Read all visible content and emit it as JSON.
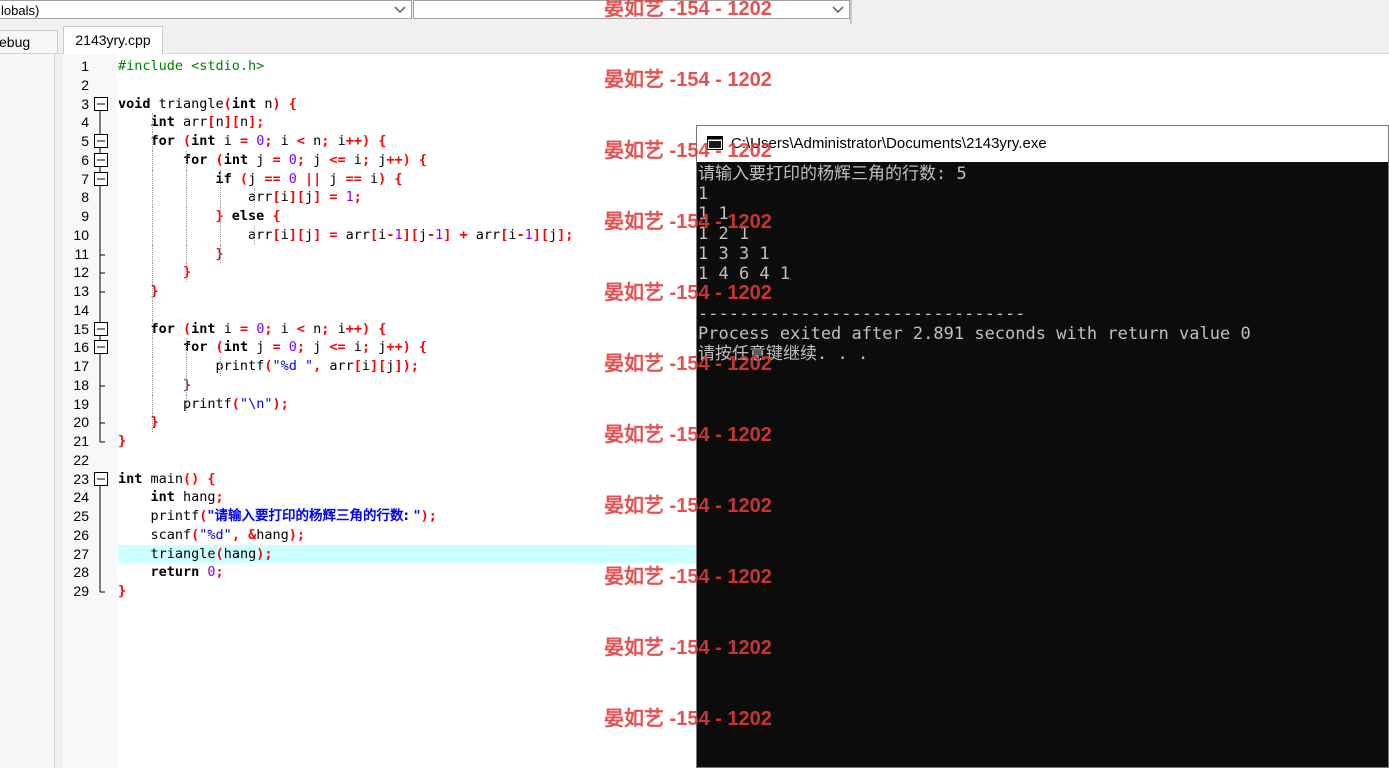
{
  "toolbar": {
    "scope_combo": "lobals)",
    "member_combo": ""
  },
  "tabs": {
    "left_tab_label": "ebug",
    "file_tab_label": "2143yry.cpp"
  },
  "editor": {
    "current_line": 27,
    "lines": [
      {
        "n": "1",
        "fold": "",
        "tokens": [
          {
            "t": "#include <stdio.h>",
            "c": "pp"
          }
        ]
      },
      {
        "n": "2",
        "fold": "",
        "tokens": []
      },
      {
        "n": "3",
        "fold": "box",
        "tokens": [
          {
            "t": "void ",
            "c": "kw"
          },
          {
            "t": "triangle",
            "c": "id"
          },
          {
            "t": "(",
            "c": "sym"
          },
          {
            "t": "int ",
            "c": "kw"
          },
          {
            "t": "n",
            "c": "id"
          },
          {
            "t": ") {",
            "c": "sym"
          }
        ]
      },
      {
        "n": "4",
        "fold": "line",
        "tokens": [
          {
            "t": "    int ",
            "c": "kw"
          },
          {
            "t": "arr",
            "c": "id"
          },
          {
            "t": "[",
            "c": "sym"
          },
          {
            "t": "n",
            "c": "id"
          },
          {
            "t": "][",
            "c": "sym"
          },
          {
            "t": "n",
            "c": "id"
          },
          {
            "t": "];",
            "c": "sym"
          }
        ]
      },
      {
        "n": "5",
        "fold": "box",
        "tokens": [
          {
            "t": "    for ",
            "c": "kw"
          },
          {
            "t": "(",
            "c": "sym"
          },
          {
            "t": "int ",
            "c": "kw"
          },
          {
            "t": "i ",
            "c": "id"
          },
          {
            "t": "= ",
            "c": "sym"
          },
          {
            "t": "0",
            "c": "num"
          },
          {
            "t": "; ",
            "c": "sym"
          },
          {
            "t": "i ",
            "c": "id"
          },
          {
            "t": "< ",
            "c": "sym"
          },
          {
            "t": "n",
            "c": "id"
          },
          {
            "t": "; ",
            "c": "sym"
          },
          {
            "t": "i",
            "c": "id"
          },
          {
            "t": "++) {",
            "c": "sym"
          }
        ]
      },
      {
        "n": "6",
        "fold": "box",
        "tokens": [
          {
            "t": "        for ",
            "c": "kw"
          },
          {
            "t": "(",
            "c": "sym"
          },
          {
            "t": "int ",
            "c": "kw"
          },
          {
            "t": "j ",
            "c": "id"
          },
          {
            "t": "= ",
            "c": "sym"
          },
          {
            "t": "0",
            "c": "num"
          },
          {
            "t": "; ",
            "c": "sym"
          },
          {
            "t": "j ",
            "c": "id"
          },
          {
            "t": "<= ",
            "c": "sym"
          },
          {
            "t": "i",
            "c": "id"
          },
          {
            "t": "; ",
            "c": "sym"
          },
          {
            "t": "j",
            "c": "id"
          },
          {
            "t": "++) {",
            "c": "sym"
          }
        ]
      },
      {
        "n": "7",
        "fold": "box",
        "tokens": [
          {
            "t": "            if ",
            "c": "kw"
          },
          {
            "t": "(",
            "c": "sym"
          },
          {
            "t": "j ",
            "c": "id"
          },
          {
            "t": "== ",
            "c": "sym"
          },
          {
            "t": "0 ",
            "c": "num"
          },
          {
            "t": "|| ",
            "c": "sym"
          },
          {
            "t": "j ",
            "c": "id"
          },
          {
            "t": "== ",
            "c": "sym"
          },
          {
            "t": "i",
            "c": "id"
          },
          {
            "t": ") {",
            "c": "sym"
          }
        ]
      },
      {
        "n": "8",
        "fold": "line",
        "tokens": [
          {
            "t": "                arr",
            "c": "id"
          },
          {
            "t": "[",
            "c": "sym"
          },
          {
            "t": "i",
            "c": "id"
          },
          {
            "t": "][",
            "c": "sym"
          },
          {
            "t": "j",
            "c": "id"
          },
          {
            "t": "] = ",
            "c": "sym"
          },
          {
            "t": "1",
            "c": "num"
          },
          {
            "t": ";",
            "c": "sym"
          }
        ]
      },
      {
        "n": "9",
        "fold": "line",
        "tokens": [
          {
            "t": "            } ",
            "c": "sym"
          },
          {
            "t": "else ",
            "c": "kw"
          },
          {
            "t": "{",
            "c": "sym"
          }
        ]
      },
      {
        "n": "10",
        "fold": "line",
        "tokens": [
          {
            "t": "                arr",
            "c": "id"
          },
          {
            "t": "[",
            "c": "sym"
          },
          {
            "t": "i",
            "c": "id"
          },
          {
            "t": "][",
            "c": "sym"
          },
          {
            "t": "j",
            "c": "id"
          },
          {
            "t": "] = ",
            "c": "sym"
          },
          {
            "t": "arr",
            "c": "id"
          },
          {
            "t": "[",
            "c": "sym"
          },
          {
            "t": "i",
            "c": "id"
          },
          {
            "t": "-",
            "c": "sym"
          },
          {
            "t": "1",
            "c": "num"
          },
          {
            "t": "][",
            "c": "sym"
          },
          {
            "t": "j",
            "c": "id"
          },
          {
            "t": "-",
            "c": "sym"
          },
          {
            "t": "1",
            "c": "num"
          },
          {
            "t": "] + ",
            "c": "sym"
          },
          {
            "t": "arr",
            "c": "id"
          },
          {
            "t": "[",
            "c": "sym"
          },
          {
            "t": "i",
            "c": "id"
          },
          {
            "t": "-",
            "c": "sym"
          },
          {
            "t": "1",
            "c": "num"
          },
          {
            "t": "][",
            "c": "sym"
          },
          {
            "t": "j",
            "c": "id"
          },
          {
            "t": "];",
            "c": "sym"
          }
        ]
      },
      {
        "n": "11",
        "fold": "end",
        "tokens": [
          {
            "t": "            }",
            "c": "sym"
          }
        ]
      },
      {
        "n": "12",
        "fold": "end",
        "tokens": [
          {
            "t": "        }",
            "c": "sym"
          }
        ]
      },
      {
        "n": "13",
        "fold": "end",
        "tokens": [
          {
            "t": "    }",
            "c": "sym"
          }
        ]
      },
      {
        "n": "14",
        "fold": "line",
        "tokens": []
      },
      {
        "n": "15",
        "fold": "box",
        "tokens": [
          {
            "t": "    for ",
            "c": "kw"
          },
          {
            "t": "(",
            "c": "sym"
          },
          {
            "t": "int ",
            "c": "kw"
          },
          {
            "t": "i ",
            "c": "id"
          },
          {
            "t": "= ",
            "c": "sym"
          },
          {
            "t": "0",
            "c": "num"
          },
          {
            "t": "; ",
            "c": "sym"
          },
          {
            "t": "i ",
            "c": "id"
          },
          {
            "t": "< ",
            "c": "sym"
          },
          {
            "t": "n",
            "c": "id"
          },
          {
            "t": "; ",
            "c": "sym"
          },
          {
            "t": "i",
            "c": "id"
          },
          {
            "t": "++) {",
            "c": "sym"
          }
        ]
      },
      {
        "n": "16",
        "fold": "box",
        "tokens": [
          {
            "t": "        for ",
            "c": "kw"
          },
          {
            "t": "(",
            "c": "sym"
          },
          {
            "t": "int ",
            "c": "kw"
          },
          {
            "t": "j ",
            "c": "id"
          },
          {
            "t": "= ",
            "c": "sym"
          },
          {
            "t": "0",
            "c": "num"
          },
          {
            "t": "; ",
            "c": "sym"
          },
          {
            "t": "j ",
            "c": "id"
          },
          {
            "t": "<= ",
            "c": "sym"
          },
          {
            "t": "i",
            "c": "id"
          },
          {
            "t": "; ",
            "c": "sym"
          },
          {
            "t": "j",
            "c": "id"
          },
          {
            "t": "++) {",
            "c": "sym"
          }
        ]
      },
      {
        "n": "17",
        "fold": "line",
        "tokens": [
          {
            "t": "            printf",
            "c": "id"
          },
          {
            "t": "(",
            "c": "sym"
          },
          {
            "t": "\"%d \"",
            "c": "str"
          },
          {
            "t": ", ",
            "c": "sym"
          },
          {
            "t": "arr",
            "c": "id"
          },
          {
            "t": "[",
            "c": "sym"
          },
          {
            "t": "i",
            "c": "id"
          },
          {
            "t": "][",
            "c": "sym"
          },
          {
            "t": "j",
            "c": "id"
          },
          {
            "t": "]);",
            "c": "sym"
          }
        ]
      },
      {
        "n": "18",
        "fold": "end",
        "tokens": [
          {
            "t": "        }",
            "c": "sym"
          }
        ]
      },
      {
        "n": "19",
        "fold": "line",
        "tokens": [
          {
            "t": "        printf",
            "c": "id"
          },
          {
            "t": "(",
            "c": "sym"
          },
          {
            "t": "\"\\n\"",
            "c": "str"
          },
          {
            "t": ");",
            "c": "sym"
          }
        ]
      },
      {
        "n": "20",
        "fold": "end",
        "tokens": [
          {
            "t": "    }",
            "c": "sym"
          }
        ]
      },
      {
        "n": "21",
        "fold": "last",
        "tokens": [
          {
            "t": "}",
            "c": "sym"
          }
        ]
      },
      {
        "n": "22",
        "fold": "",
        "tokens": []
      },
      {
        "n": "23",
        "fold": "box",
        "tokens": [
          {
            "t": "int ",
            "c": "kw"
          },
          {
            "t": "main",
            "c": "id"
          },
          {
            "t": "() {",
            "c": "sym"
          }
        ]
      },
      {
        "n": "24",
        "fold": "line",
        "tokens": [
          {
            "t": "    int ",
            "c": "kw"
          },
          {
            "t": "hang",
            "c": "id"
          },
          {
            "t": ";",
            "c": "sym"
          }
        ]
      },
      {
        "n": "25",
        "fold": "line",
        "tokens": [
          {
            "t": "    printf",
            "c": "id"
          },
          {
            "t": "(",
            "c": "sym"
          },
          {
            "t": "\"请输入要打印的杨辉三角的行数: \"",
            "c": "strcn"
          },
          {
            "t": ");",
            "c": "sym"
          }
        ]
      },
      {
        "n": "26",
        "fold": "line",
        "tokens": [
          {
            "t": "    scanf",
            "c": "id"
          },
          {
            "t": "(",
            "c": "sym"
          },
          {
            "t": "\"%d\"",
            "c": "str"
          },
          {
            "t": ", &",
            "c": "sym"
          },
          {
            "t": "hang",
            "c": "id"
          },
          {
            "t": ");",
            "c": "sym"
          }
        ]
      },
      {
        "n": "27",
        "fold": "line",
        "tokens": [
          {
            "t": "    triangle",
            "c": "id"
          },
          {
            "t": "(",
            "c": "sym"
          },
          {
            "t": "hang",
            "c": "id"
          },
          {
            "t": ");",
            "c": "sym"
          }
        ]
      },
      {
        "n": "28",
        "fold": "line",
        "tokens": [
          {
            "t": "    return ",
            "c": "kw"
          },
          {
            "t": "0",
            "c": "num"
          },
          {
            "t": ";",
            "c": "sym"
          }
        ]
      },
      {
        "n": "29",
        "fold": "last",
        "tokens": [
          {
            "t": "}",
            "c": "sym"
          }
        ]
      }
    ]
  },
  "console": {
    "title": "C:\\Users\\Administrator\\Documents\\2143yry.exe",
    "lines": [
      "请输入要打印的杨辉三角的行数: 5",
      "1",
      "1 1",
      "1 2 1",
      "1 3 3 1",
      "1 4 6 4 1",
      "",
      "--------------------------------",
      "Process exited after 2.891 seconds with return value 0",
      "请按任意键继续. . ."
    ]
  },
  "watermark": {
    "text": "晏如艺 -154 - 1202",
    "count": 11
  },
  "colors": {
    "keyword": "#000000",
    "preprocessor": "#008000",
    "number": "#8000ff",
    "string": "#0000ff",
    "symbol": "#ff0000",
    "current_line": "#ccffff",
    "console_bg": "#0c0c0c",
    "console_fg": "#c0c0c0",
    "watermark": "#e23a3a"
  }
}
